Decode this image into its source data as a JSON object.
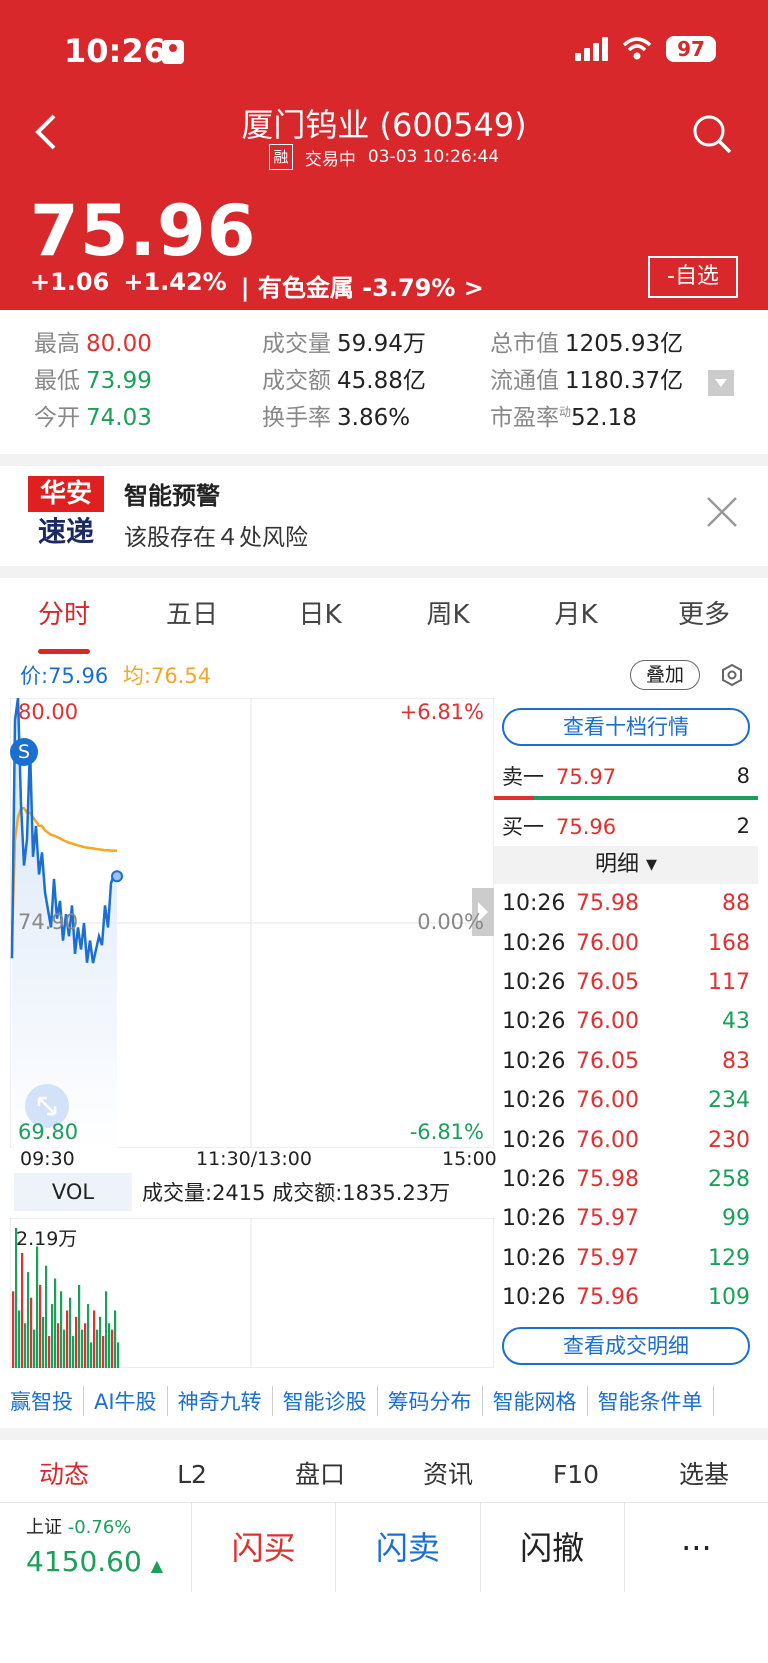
{
  "status": {
    "time": "10:26",
    "battery": "97"
  },
  "header": {
    "title": "厦门钨业 (600549)",
    "rong": "融",
    "trade_status": "交易中",
    "datetime": "03-03 10:26:44",
    "price": "75.96",
    "change": "+1.06",
    "change_pct": "+1.42%",
    "sector": "| 有色金属 -3.79% >",
    "watchlist": "-自选"
  },
  "stats": {
    "high_k": "最高",
    "high_v": "80.00",
    "low_k": "最低",
    "low_v": "73.99",
    "open_k": "今开",
    "open_v": "74.03",
    "vol_k": "成交量",
    "vol_v": "59.94万",
    "amt_k": "成交额",
    "amt_v": "45.88亿",
    "turn_k": "换手率",
    "turn_v": "3.86%",
    "mcap_k": "总市值",
    "mcap_v": "1205.93亿",
    "float_k": "流通值",
    "float_v": "1180.37亿",
    "pe_k": "市盈率",
    "pe_sup": "动",
    "pe_v": "52.18"
  },
  "alert": {
    "logo_top": "华安",
    "logo_bottom": "速递",
    "title": "智能预警",
    "text": "该股存在４处风险"
  },
  "tabs": [
    "分时",
    "五日",
    "日K",
    "周K",
    "月K",
    "更多"
  ],
  "chart_header": {
    "price_label": "价:75.96",
    "avg_label": "均:76.54",
    "overlay": "叠加"
  },
  "chart_labels": {
    "top": "80.00",
    "mid": "74.90",
    "bottom": "69.80",
    "pct_top": "+6.81%",
    "pct_mid": "0.00%",
    "pct_bottom": "-6.81%",
    "t_start": "09:30",
    "t_mid": "11:30/13:00",
    "t_end": "15:00",
    "marker": "S"
  },
  "chart_data": {
    "type": "line",
    "ylim": [
      69.8,
      80.0
    ],
    "series": [
      {
        "name": "价",
        "values": [
          74.1,
          79.5,
          80.0,
          77.6,
          76.2,
          76.8,
          78.9,
          76.4,
          77.1,
          76.0,
          76.5,
          75.6,
          75.2,
          74.8,
          75.9,
          75.0,
          75.4,
          74.5,
          75.1,
          74.6,
          75.3,
          74.2,
          74.8,
          74.3,
          74.9,
          74.0,
          74.5,
          73.99,
          74.3,
          74.6,
          74.4,
          75.3,
          74.8,
          75.8,
          76.0,
          75.96
        ]
      },
      {
        "name": "均",
        "values": [
          74.5,
          76.8,
          77.3,
          77.5,
          77.5,
          77.4,
          77.4,
          77.3,
          77.2,
          77.1,
          77.1,
          77.0,
          76.95,
          76.9,
          76.88,
          76.85,
          76.82,
          76.78,
          76.75,
          76.72,
          76.7,
          76.68,
          76.66,
          76.64,
          76.62,
          76.61,
          76.6,
          76.59,
          76.58,
          76.57,
          76.56,
          76.55,
          76.55,
          76.54,
          76.54,
          76.54
        ]
      }
    ]
  },
  "orderbook": {
    "full_btn": "查看十档行情",
    "sell_label": "卖一",
    "sell_price": "75.97",
    "sell_vol": "8",
    "buy_label": "买一",
    "buy_price": "75.96",
    "buy_vol": "2",
    "detail_title": "明细 ▾",
    "detail_btn": "查看成交明细"
  },
  "trades": [
    {
      "t": "10:26",
      "p": "75.98",
      "v": "88",
      "c": "red"
    },
    {
      "t": "10:26",
      "p": "76.00",
      "v": "168",
      "c": "red"
    },
    {
      "t": "10:26",
      "p": "76.05",
      "v": "117",
      "c": "red"
    },
    {
      "t": "10:26",
      "p": "76.00",
      "v": "43",
      "c": "green"
    },
    {
      "t": "10:26",
      "p": "76.05",
      "v": "83",
      "c": "red"
    },
    {
      "t": "10:26",
      "p": "76.00",
      "v": "234",
      "c": "green"
    },
    {
      "t": "10:26",
      "p": "76.00",
      "v": "230",
      "c": "red"
    },
    {
      "t": "10:26",
      "p": "75.98",
      "v": "258",
      "c": "green"
    },
    {
      "t": "10:26",
      "p": "75.97",
      "v": "99",
      "c": "green"
    },
    {
      "t": "10:26",
      "p": "75.97",
      "v": "129",
      "c": "green"
    },
    {
      "t": "10:26",
      "p": "75.96",
      "v": "109",
      "c": "green"
    }
  ],
  "vol": {
    "label": "VOL",
    "text": "成交量:2415 成交额:1835.23万",
    "max": "2.19万"
  },
  "vol_data": [
    1.2,
    2.19,
    0.9,
    1.8,
    0.7,
    1.5,
    1.1,
    0.6,
    1.9,
    1.3,
    0.8,
    1.6,
    0.5,
    1.0,
    1.4,
    0.7,
    1.2,
    0.6,
    0.9,
    1.1,
    0.5,
    0.8,
    1.3,
    0.6,
    0.7,
    1.0,
    0.4,
    0.9,
    0.6,
    0.8,
    0.5,
    1.2,
    0.7,
    0.6,
    0.9,
    0.4
  ],
  "tools": [
    "赢智投",
    "AI牛股",
    "神奇九转",
    "智能诊股",
    "筹码分布",
    "智能网格",
    "智能条件单"
  ],
  "bottom_tabs": [
    "动态",
    "L2",
    "盘口",
    "资讯",
    "F10",
    "选基"
  ],
  "footer": {
    "index_name": "上证",
    "index_change": "-0.76%",
    "index_value": "4150.60",
    "flash_buy": "闪买",
    "flash_sell": "闪卖",
    "flash_cancel": "闪撤",
    "more": "···"
  }
}
